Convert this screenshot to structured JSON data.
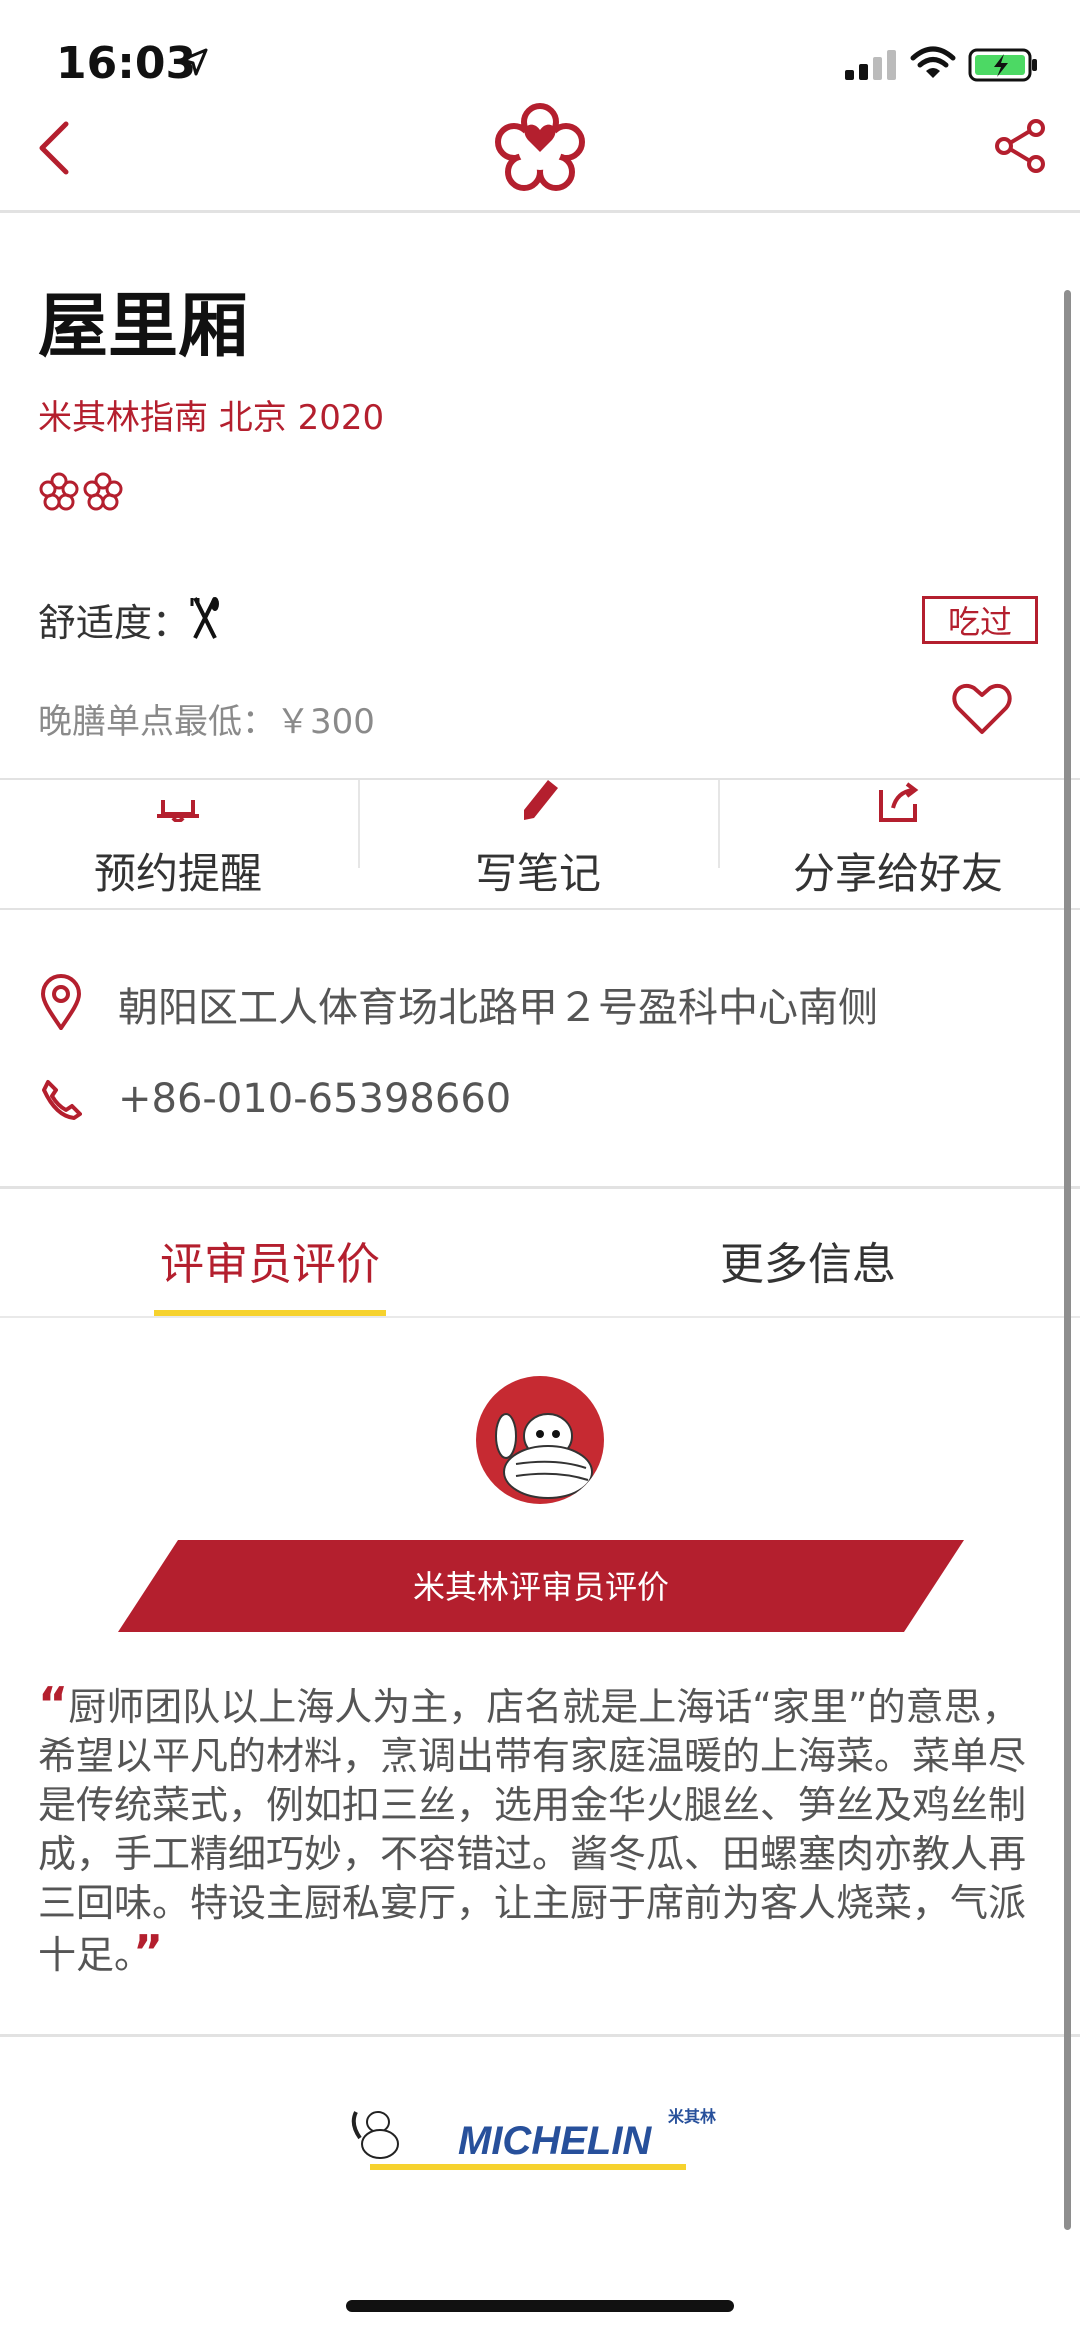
{
  "status_bar": {
    "time": "16:03"
  },
  "nav": {
    "back_label": "",
    "share_label": ""
  },
  "restaurant": {
    "name": "屋里厢",
    "guide": "米其林指南 北京  2020",
    "stars": 2,
    "comfort_label": "舒适度：",
    "eaten_label": "吃过",
    "price_label": "晚膳单点最低：￥300"
  },
  "actions": [
    {
      "label": "预约提醒",
      "icon": "bell-icon"
    },
    {
      "label": "写笔记",
      "icon": "pencil-icon"
    },
    {
      "label": "分享给好友",
      "icon": "share-box-icon"
    }
  ],
  "info": {
    "address": "朝阳区工人体育场北路甲２号盈科中心南侧",
    "phone": "+86-010-65398660"
  },
  "tabs": [
    {
      "label": "评审员评价",
      "active": true
    },
    {
      "label": "更多信息",
      "active": false
    }
  ],
  "review": {
    "banner_label": "米其林评审员评价",
    "open_quote": "“",
    "text": "厨师团队以上海人为主，店名就是上海话“家里”的意思，希望以平凡的材料，烹调出带有家庭温暖的上海菜。菜单尽是传统菜式，例如扣三丝，选用金华火腿丝、笋丝及鸡丝制成，手工精细巧妙，不容错过。酱冬瓜、田螺塞肉亦教人再三回味。特设主厨私宴厅，让主厨于席前为客人烧菜，气派十足。",
    "close_quote": "”"
  },
  "footer": {
    "brand": "MICHELIN",
    "brand_cn": "米其林"
  },
  "colors": {
    "accent": "#b41f2e",
    "tab_underline": "#f6d22e"
  }
}
